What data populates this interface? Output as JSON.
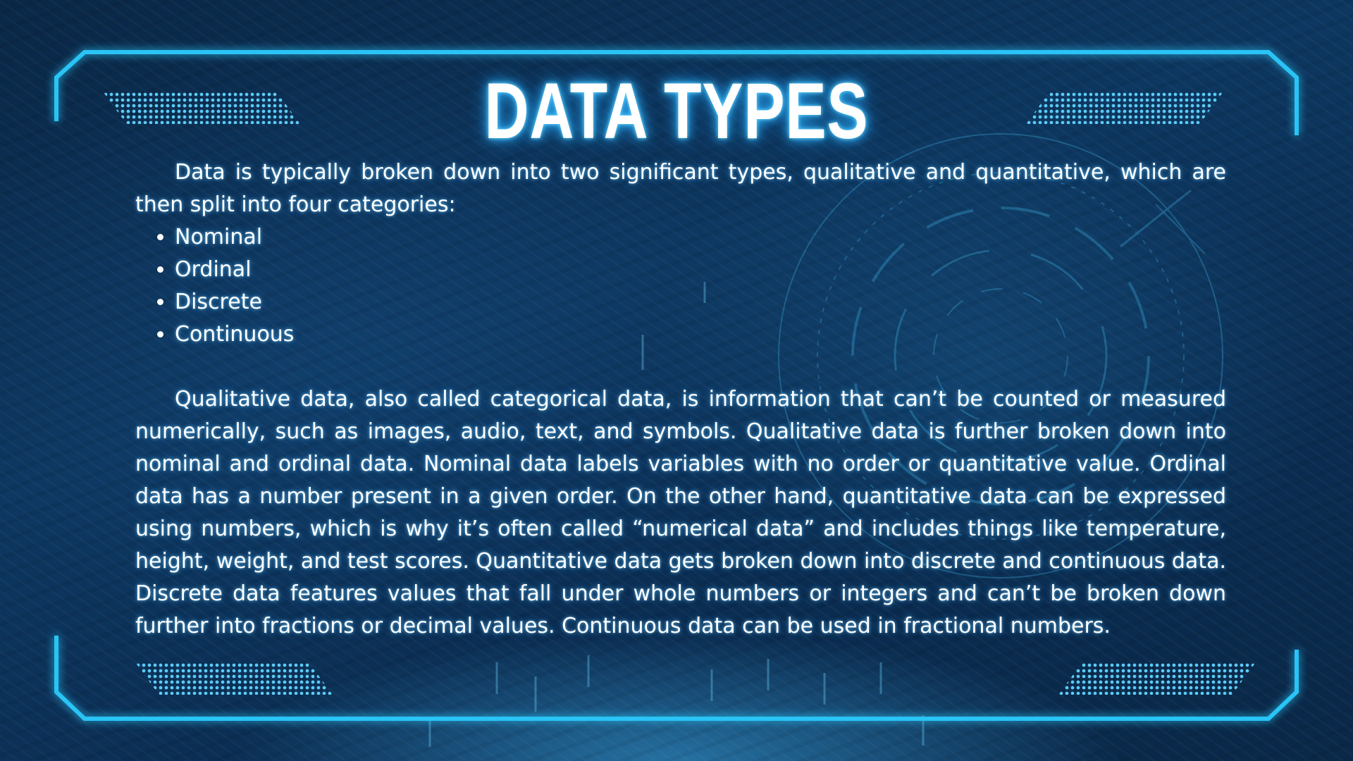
{
  "slide": {
    "title": "DATA TYPES",
    "intro": "Data is typically broken down into two significant types, qualitative and quantitative, which are then split into four categories:",
    "categories": [
      "Nominal",
      "Ordinal",
      "Discrete",
      "Continuous"
    ],
    "body": "Qualitative data, also called categorical data, is information that can’t be counted or measured numerically, such as images, audio, text, and symbols. Qualitative data is further broken down into nominal and ordinal data. Nominal data labels variables with no order or quantitative value. Ordinal data has a number present in a given order. On the other hand, quantitative data can be expressed using numbers, which is why it’s often called “numerical data” and includes things like temperature, height, weight, and test scores. Quantitative data gets broken down into discrete and continuous data. Discrete data features values that fall under whole numbers or integers and can’t be broken down further into fractions or decimal values. Continuous data can be used in fractional numbers."
  },
  "colors": {
    "frame": "#29c4f5",
    "dots": "#5fd3ff",
    "background": "#0b2d52",
    "text": "#ffffff"
  }
}
